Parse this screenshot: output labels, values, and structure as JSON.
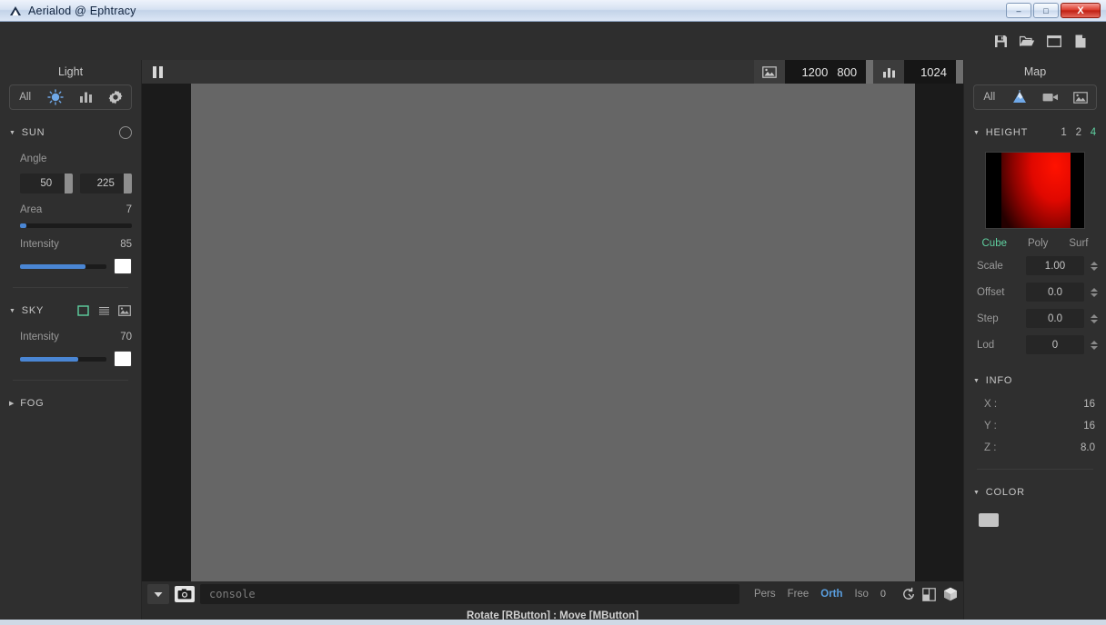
{
  "window": {
    "title": "Aerialod @ Ephtracy",
    "app_icon": "triangle-icon",
    "minimize": "–",
    "maximize": "□",
    "close": "X"
  },
  "toolbar": {
    "icons": [
      {
        "name": "save-icon",
        "label": "Save"
      },
      {
        "name": "open-folder-icon",
        "label": "Open"
      },
      {
        "name": "window-icon",
        "label": "Window"
      },
      {
        "name": "new-file-icon",
        "label": "New"
      }
    ]
  },
  "light_panel": {
    "title": "Light",
    "tabs": [
      {
        "label": "All",
        "name": "tab-all",
        "active": false
      },
      {
        "label": "",
        "name": "sun-icon",
        "active": true
      },
      {
        "label": "",
        "name": "bar-chart-icon",
        "active": false
      },
      {
        "label": "",
        "name": "gear-icon",
        "active": false
      }
    ],
    "sun": {
      "header": "SUN",
      "angle_label": "Angle",
      "angle_1": "50",
      "angle_2": "225",
      "area_label": "Area",
      "area_value": "7",
      "area_pct": 6,
      "intensity_label": "Intensity",
      "intensity_value": "85",
      "intensity_pct": 76,
      "swatch_color": "#ffffff"
    },
    "sky": {
      "header": "SKY",
      "modes": [
        "sky-solid-icon",
        "sky-gradient-icon",
        "sky-image-icon"
      ],
      "selected_mode": 0,
      "intensity_label": "Intensity",
      "intensity_value": "70",
      "intensity_pct": 67,
      "swatch_color": "#ffffff"
    },
    "fog": {
      "header": "FOG"
    }
  },
  "viewport": {
    "pause": "pause-icon",
    "image_icon": "image-icon",
    "resolution_w": "1200",
    "resolution_h": "800",
    "samples_icon": "bar-chart-icon",
    "samples": "1024",
    "status_text": "Rotate [RButton] : Move [MButton]"
  },
  "console": {
    "dropdown_icon": "chevron-down-icon",
    "camera_icon": "camera-icon",
    "placeholder": "console",
    "value": ""
  },
  "projection": {
    "options": [
      {
        "label": "Pers",
        "active": false
      },
      {
        "label": "Free",
        "active": false
      },
      {
        "label": "Orth",
        "active": true
      },
      {
        "label": "Iso",
        "active": false
      }
    ],
    "number": "0",
    "icons": [
      "rotate-icon",
      "grid-snap-icon",
      "cube-icon"
    ]
  },
  "map_panel": {
    "title": "Map",
    "tabs": [
      {
        "label": "All",
        "name": "tab-all",
        "active": false
      },
      {
        "label": "",
        "name": "mountain-icon",
        "active": true
      },
      {
        "label": "",
        "name": "video-camera-icon",
        "active": false
      },
      {
        "label": "",
        "name": "image-icon",
        "active": false
      }
    ],
    "height": {
      "header": "HEIGHT",
      "scales": [
        {
          "label": "1",
          "active": false
        },
        {
          "label": "2",
          "active": false
        },
        {
          "label": "4",
          "active": true
        }
      ],
      "preview_name": "height-map-preview",
      "geometry_modes": [
        {
          "label": "Cube",
          "active": true
        },
        {
          "label": "Poly",
          "active": false
        },
        {
          "label": "Surf",
          "active": false
        }
      ],
      "fields": [
        {
          "label": "Scale",
          "value": "1.00"
        },
        {
          "label": "Offset",
          "value": "0.0"
        },
        {
          "label": "Step",
          "value": "0.0"
        },
        {
          "label": "Lod",
          "value": "0"
        }
      ]
    },
    "info": {
      "header": "INFO",
      "rows": [
        {
          "label": "X :",
          "value": "16"
        },
        {
          "label": "Y :",
          "value": "16"
        },
        {
          "label": "Z :",
          "value": "8.0"
        }
      ]
    },
    "color": {
      "header": "COLOR",
      "swatch": "#c4c4c4"
    }
  },
  "theme": {
    "accent_blue": "#4a86d4",
    "accent_green": "#5fd0a0",
    "panel_bg": "#2f2f2f",
    "canvas_bg": "#666666"
  }
}
